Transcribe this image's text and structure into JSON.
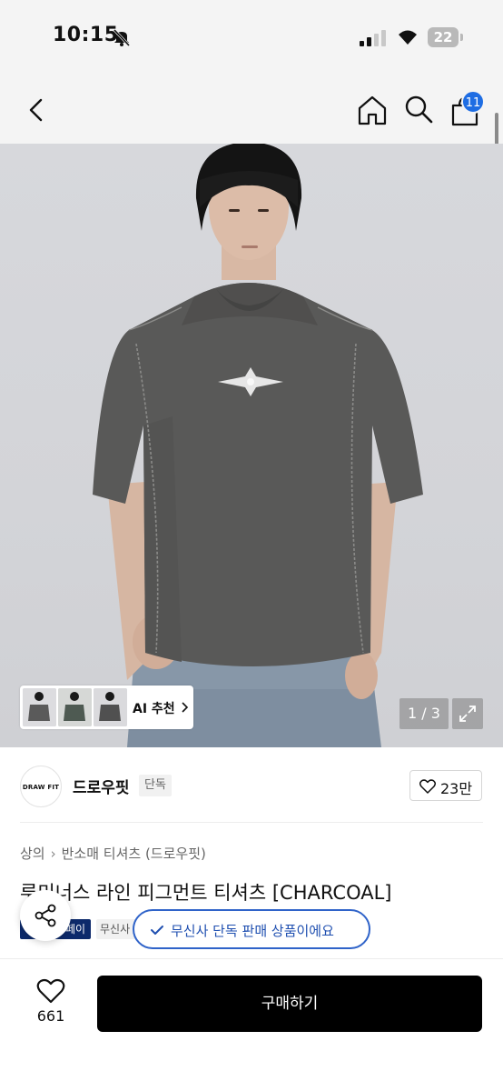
{
  "status_bar": {
    "time": "10:15",
    "battery": "22"
  },
  "nav": {
    "cart_count": "11"
  },
  "gallery": {
    "ai_recommend_label": "AI 추천",
    "page_indicator": "1 / 3"
  },
  "brand": {
    "logo_text": "DRAW FIT",
    "name": "드로우핏",
    "tag": "단독",
    "like_count": "23만"
  },
  "product": {
    "breadcrumb": [
      "상의",
      "반소매 티셔츠 (드로우핏)"
    ],
    "title": "루미너스 라인 피그먼트 티셔츠 [CHARCOAL]",
    "badge_pay": "페이",
    "badge_musinsa": "무신사"
  },
  "toast": {
    "text": "무신사 단독 판매 상품이에요"
  },
  "bottom": {
    "wish_count": "661",
    "buy_label": "구매하기"
  },
  "colors": {
    "accent_blue": "#1e6de3",
    "toast_border": "#2f63c9",
    "buy_button": "#000000",
    "pay_badge": "#0d2a6b"
  }
}
